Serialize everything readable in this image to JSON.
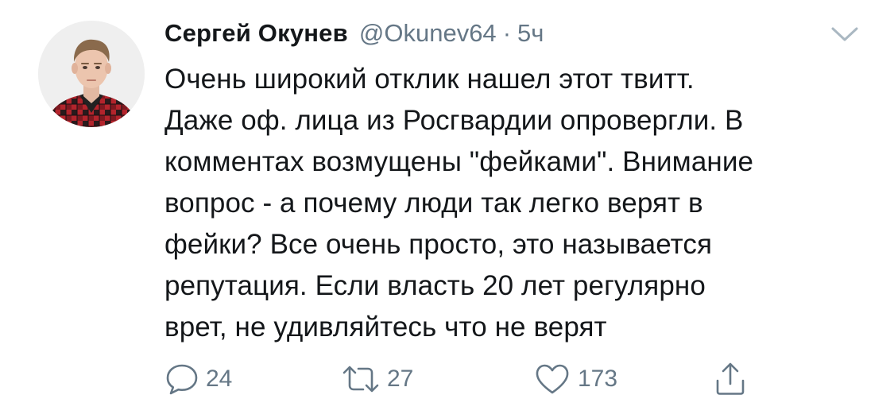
{
  "tweet": {
    "author_name": "Сергей Окунев",
    "handle": "@Okunev64",
    "separator": "·",
    "time": "5ч",
    "text": "Очень широкий отклик нашел этот твитт.\nДаже оф. лица из Росгвардии опровергли. В\nкомментах возмущены \"фейками\". Внимание\nвопрос - а почему люди так легко верят в\nфейки? Все очень просто, это называется\nрепутация. Если власть 20 лет регулярно\nврет, не удивляйтесь что не верят",
    "replies": "24",
    "retweets": "27",
    "likes": "173"
  },
  "icons": {
    "caret": "chevron-down-icon",
    "reply": "reply-icon",
    "retweet": "retweet-icon",
    "like": "heart-icon",
    "share": "share-icon"
  },
  "colors": {
    "text": "#14171a",
    "secondary": "#657786",
    "shirt_red": "#b3242c"
  }
}
